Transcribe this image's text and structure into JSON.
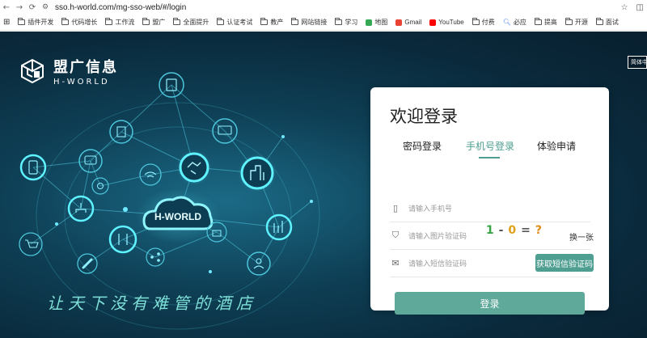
{
  "browser": {
    "url": "sso.h-world.com/mg-sso-web/#/login",
    "bookmarks": [
      "插件开发",
      "代码增长",
      "工作流",
      "盟广",
      "全面提升",
      "认证考试",
      "教产",
      "网站链接",
      "学习",
      "地图",
      "Gmail",
      "YouTube",
      "付费",
      "必应",
      "提高",
      "开源",
      "面试"
    ]
  },
  "brand": {
    "name_cn": "盟广信息",
    "name_en": "H-WORLD",
    "lang_button": "简体中"
  },
  "network": {
    "center_label": "H-WORLD"
  },
  "slogan": "让天下没有难管的酒店",
  "login": {
    "title": "欢迎登录",
    "tabs": [
      "密码登录",
      "手机号登录",
      "体验申请"
    ],
    "active_tab_index": 1,
    "phone_placeholder": "请输入手机号",
    "captcha_placeholder": "请输入图片验证码",
    "captcha_chars": [
      "1",
      "-",
      "0",
      "=",
      "?"
    ],
    "captcha_refresh": "换一张",
    "sms_placeholder": "请输入短信验证码",
    "sms_button": "获取短信验证码",
    "submit": "登录"
  },
  "colors": {
    "accent": "#4e9e91",
    "hero_bg": "#0e3f55",
    "node_glow": "#48e6ff"
  }
}
